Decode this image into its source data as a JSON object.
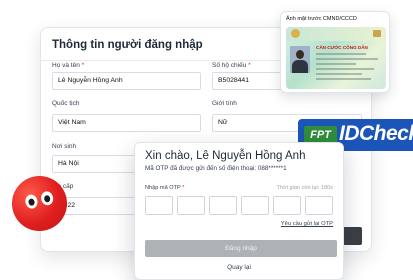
{
  "login_form": {
    "title": "Thông tin người đăng nhập",
    "fields": [
      {
        "label": "Họ và tên",
        "required": "*",
        "value": "Lê Nguyễn Hồng Anh"
      },
      {
        "label": "Số hộ chiếu",
        "required": "*",
        "value": "B5028441"
      },
      {
        "label": "Quốc tịch",
        "value": "Việt Nam"
      },
      {
        "label": "Giới tính",
        "value": "Nữ"
      },
      {
        "label": "Nơi sinh",
        "value": "Hà Nội"
      },
      {
        "label": "...p cấp",
        "value": "...022"
      }
    ]
  },
  "id_card": {
    "title": "Ảnh mặt trước CMND/CCCD",
    "card_heading": "CĂN CƯỚC CÔNG DÂN"
  },
  "brand": {
    "prefix": "FPT",
    "product": "IDCheck",
    "colors": {
      "blue": "#1c55b8",
      "green": "#2f8d3b",
      "mascot_red": "#e01f1f"
    }
  },
  "otp": {
    "greeting": "Xin chào, Lê Nguyễn Hồng Anh",
    "subtitle": "Mã OTP đã được gửi đến số điện thoại: 088******1",
    "label": "Nhập mã OTP",
    "required": "*",
    "timer": "Thời gian còn lại: 180s",
    "digits": [
      "",
      "",
      "",
      "",
      "",
      ""
    ],
    "resend": "Yêu cầu gửi lại OTP",
    "submit": "Đăng nhập",
    "back": "Quay lại"
  }
}
